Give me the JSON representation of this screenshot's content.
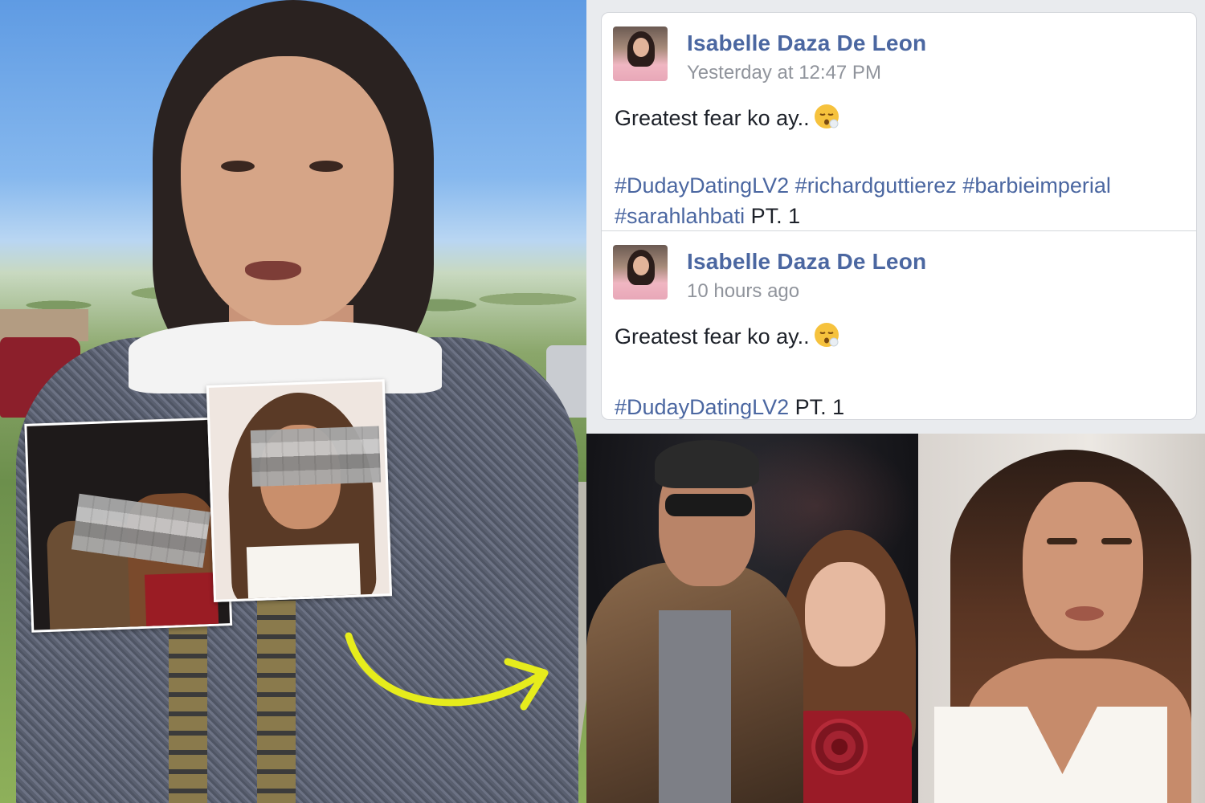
{
  "posts": [
    {
      "author": "Isabelle Daza De Leon",
      "time": "Yesterday at 12:47 PM",
      "text": "Greatest fear ko ay..",
      "emoji": "face-exhaling-emoji",
      "hashtags": [
        "#DudayDatingLV2",
        "#richardguttierez",
        "#barbieimperial",
        "#sarahlahbati"
      ],
      "suffix": "PT. 1"
    },
    {
      "author": "Isabelle Daza De Leon",
      "time": "10 hours ago",
      "text": "Greatest fear ko ay..",
      "emoji": "face-exhaling-emoji",
      "hashtags": [
        "#DudayDatingLV2"
      ],
      "suffix": "PT. 1"
    }
  ],
  "colors": {
    "author_link": "#4b67a1",
    "timestamp": "#90949c",
    "arrow": "#e6ec1c"
  }
}
